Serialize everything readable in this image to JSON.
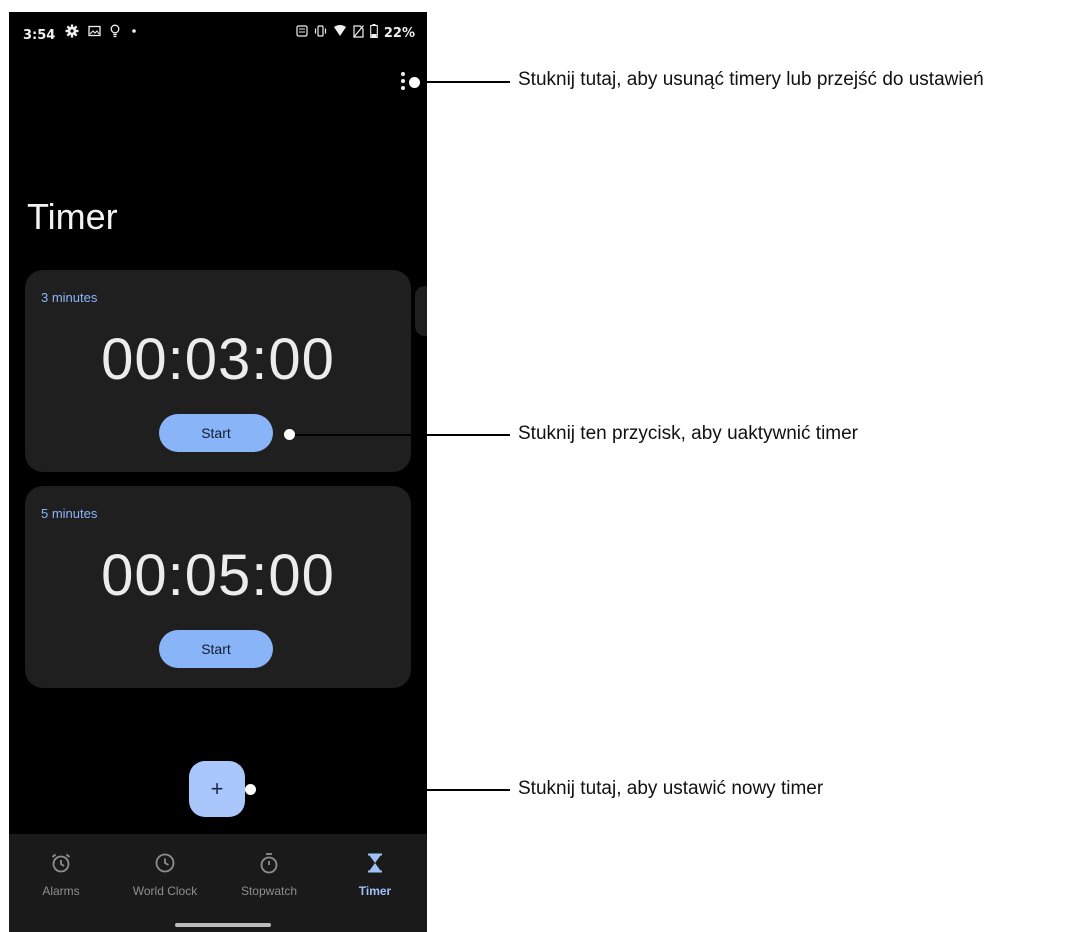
{
  "status_bar": {
    "time": "3:54",
    "battery": "22%",
    "left_icons": [
      "settings-icon",
      "image-icon",
      "lightbulb-icon",
      "dot-icon"
    ],
    "right_icons": [
      "nfc-icon",
      "vibrate-icon",
      "wifi-icon",
      "no-sim-icon",
      "battery-icon"
    ]
  },
  "header": {
    "title": "Timer",
    "menu_icon": "more-vert-icon"
  },
  "timers": [
    {
      "label": "3 minutes",
      "time": "00:03:00",
      "button": "Start"
    },
    {
      "label": "5 minutes",
      "time": "00:05:00",
      "button": "Start"
    }
  ],
  "fab": {
    "label": "+"
  },
  "bottom_nav": [
    {
      "label": "Alarms",
      "icon": "alarm-icon",
      "active": false
    },
    {
      "label": "World Clock",
      "icon": "clock-icon",
      "active": false
    },
    {
      "label": "Stopwatch",
      "icon": "stopwatch-icon",
      "active": false
    },
    {
      "label": "Timer",
      "icon": "hourglass-icon",
      "active": true
    }
  ],
  "callouts": {
    "menu": "Stuknij tutaj, aby usunąć timery lub przejść do ustawień",
    "start": "Stuknij ten przycisk, aby uaktywnić timer",
    "add": "Stuknij tutaj, aby ustawić nowy timer"
  },
  "colors": {
    "accent": "#8ab4f8",
    "fab": "#a9c7fa",
    "card": "#1f1f1f",
    "background": "#000000",
    "nav_background": "#1a1a1a"
  }
}
